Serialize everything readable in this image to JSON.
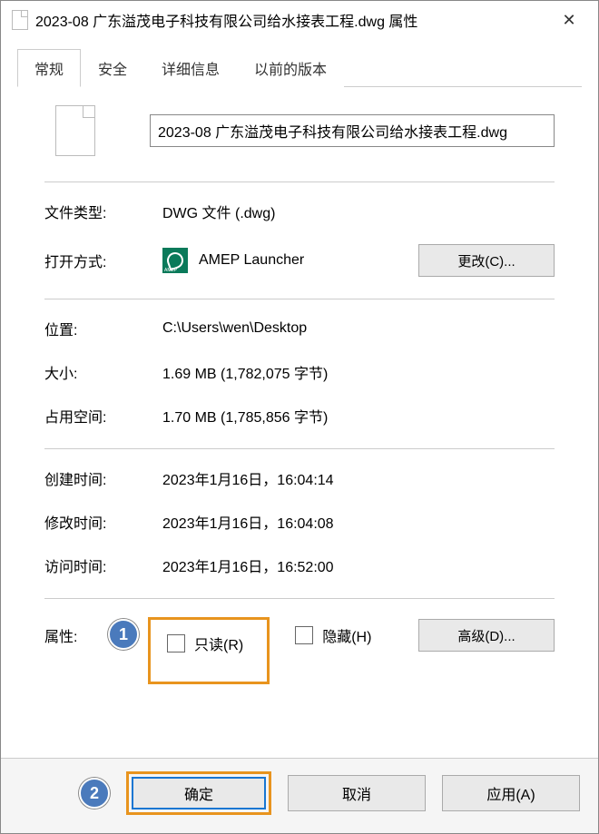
{
  "titlebar": {
    "title": "2023-08 广东溢茂电子科技有限公司给水接表工程.dwg 属性"
  },
  "tabs": {
    "general": "常规",
    "security": "安全",
    "details": "详细信息",
    "previous": "以前的版本"
  },
  "file": {
    "name_value": "2023-08 广东溢茂电子科技有限公司给水接表工程.dwg"
  },
  "labels": {
    "filetype": "文件类型:",
    "opens_with": "打开方式:",
    "location": "位置:",
    "size": "大小:",
    "size_on_disk": "占用空间:",
    "created": "创建时间:",
    "modified": "修改时间:",
    "accessed": "访问时间:",
    "attributes": "属性:"
  },
  "values": {
    "filetype": "DWG 文件 (.dwg)",
    "opens_with": "AMEP Launcher",
    "location": "C:\\Users\\wen\\Desktop",
    "size": "1.69 MB (1,782,075 字节)",
    "size_on_disk": "1.70 MB (1,785,856 字节)",
    "created": "2023年1月16日，16:04:14",
    "modified": "2023年1月16日，16:04:08",
    "accessed": "2023年1月16日，16:52:00"
  },
  "buttons": {
    "change": "更改(C)...",
    "advanced": "高级(D)...",
    "ok": "确定",
    "cancel": "取消",
    "apply": "应用(A)"
  },
  "checkboxes": {
    "readonly": "只读(R)",
    "hidden": "隐藏(H)"
  },
  "annotations": {
    "one": "1",
    "two": "2"
  }
}
